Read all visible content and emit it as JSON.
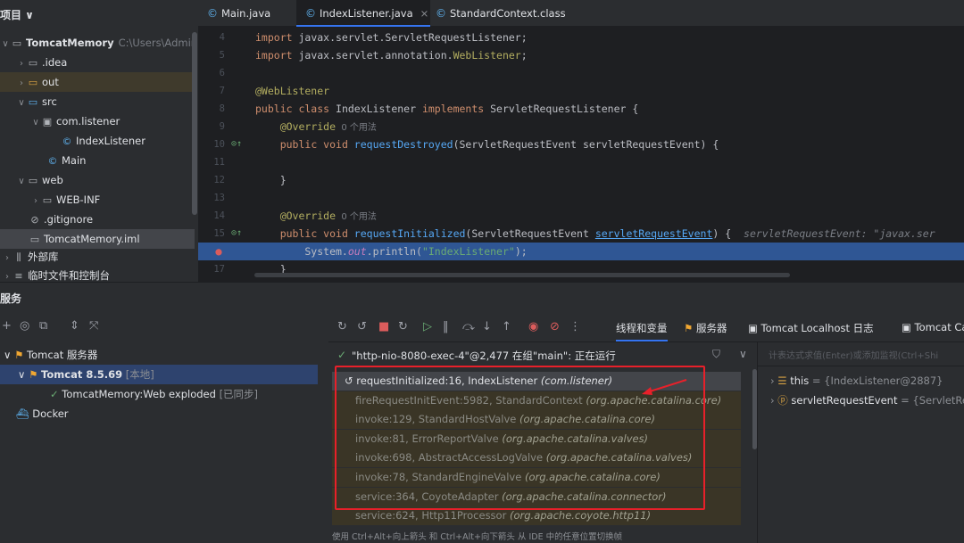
{
  "project": {
    "title": "项目 ∨",
    "root": {
      "name": "TomcatMemory",
      "path": "C:\\Users\\Administ"
    },
    "items": [
      {
        "label": ".idea"
      },
      {
        "label": "out"
      },
      {
        "label": "src"
      },
      {
        "label": "com.listener"
      },
      {
        "label": "IndexListener"
      },
      {
        "label": "Main"
      },
      {
        "label": "web"
      },
      {
        "label": "WEB-INF"
      },
      {
        "label": ".gitignore"
      },
      {
        "label": "TomcatMemory.iml"
      },
      {
        "label": "外部库"
      },
      {
        "label": "临时文件和控制台"
      }
    ]
  },
  "tabs": [
    {
      "label": "Main.java"
    },
    {
      "label": "IndexListener.java",
      "close": "×"
    },
    {
      "label": "StandardContext.class"
    }
  ],
  "editor": {
    "lines": [
      {
        "num": "4",
        "parts": [
          [
            "kw",
            "import "
          ],
          [
            "",
            "javax.servlet.ServletRequestListener;"
          ]
        ]
      },
      {
        "num": "5",
        "parts": [
          [
            "kw",
            "import "
          ],
          [
            "",
            "javax.servlet.annotation."
          ],
          [
            "an",
            "WebListener"
          ],
          [
            "",
            ";"
          ]
        ]
      },
      {
        "num": "6",
        "parts": []
      },
      {
        "num": "7",
        "parts": [
          [
            "an",
            "@WebListener"
          ]
        ]
      },
      {
        "num": "8",
        "parts": [
          [
            "kw",
            "public class "
          ],
          [
            "",
            "IndexListener "
          ],
          [
            "kw",
            "implements "
          ],
          [
            "",
            "ServletRequestListener {"
          ]
        ]
      },
      {
        "num": "9",
        "parts": [
          [
            "",
            "    "
          ],
          [
            "an",
            "@Override"
          ],
          [
            "hint",
            "  0 个用法"
          ]
        ]
      },
      {
        "num": "10",
        "parts": [
          [
            "",
            "    "
          ],
          [
            "kw",
            "public void "
          ],
          [
            "fn",
            "requestDestroyed"
          ],
          [
            "",
            "(ServletRequestEvent servletRequestEvent) {"
          ]
        ]
      },
      {
        "num": "11",
        "parts": []
      },
      {
        "num": "12",
        "parts": [
          [
            "",
            "    }"
          ]
        ]
      },
      {
        "num": "13",
        "parts": []
      },
      {
        "num": "14",
        "parts": [
          [
            "",
            "    "
          ],
          [
            "an",
            "@Override"
          ],
          [
            "hint",
            "  0 个用法"
          ]
        ]
      },
      {
        "num": "15",
        "parts": [
          [
            "",
            "    "
          ],
          [
            "kw",
            "public void "
          ],
          [
            "fn",
            "requestInitialized"
          ],
          [
            "",
            "(ServletRequestEvent "
          ],
          [
            "pu",
            "servletRequestEvent"
          ],
          [
            "",
            ") {  "
          ],
          [
            "inl",
            "servletRequestEvent: \"javax.ser"
          ]
        ]
      },
      {
        "num": "",
        "parts": [
          [
            "",
            "        System."
          ],
          [
            "fl",
            "out"
          ],
          [
            "",
            ".println("
          ],
          [
            "st",
            "\"IndexListener\""
          ],
          [
            "",
            ");"
          ]
        ]
      },
      {
        "num": "17",
        "parts": [
          [
            "",
            "    }"
          ]
        ]
      }
    ]
  },
  "services": {
    "title": "服务",
    "tree": [
      {
        "label": "Tomcat 服务器"
      },
      {
        "label": "Tomcat 8.5.69",
        "tag": "[本地]"
      },
      {
        "label": "TomcatMemory:Web exploded",
        "tag": "[已同步]"
      },
      {
        "label": "Docker"
      }
    ]
  },
  "debugger": {
    "tabs": [
      {
        "label": "线程和变量"
      },
      {
        "label": "服务器"
      },
      {
        "label": "Tomcat Localhost 日志"
      },
      {
        "label": "Tomcat Ca"
      }
    ],
    "thread": "\"http-nio-8080-exec-4\"@2,477 在组\"main\": 正在运行",
    "frames": [
      {
        "method": "requestInitialized:16, IndexListener",
        "pkg": "(com.listener)"
      },
      {
        "method": "fireRequestInitEvent:5982, StandardContext",
        "pkg": "(org.apache.catalina.core)"
      },
      {
        "method": "invoke:129, StandardHostValve",
        "pkg": "(org.apache.catalina.core)"
      },
      {
        "method": "invoke:81, ErrorReportValve",
        "pkg": "(org.apache.catalina.valves)"
      },
      {
        "method": "invoke:698, AbstractAccessLogValve",
        "pkg": "(org.apache.catalina.valves)"
      },
      {
        "method": "invoke:78, StandardEngineValve",
        "pkg": "(org.apache.catalina.core)"
      },
      {
        "method": "service:364, CoyoteAdapter",
        "pkg": "(org.apache.catalina.connector)"
      },
      {
        "method": "service:624, Http11Processor",
        "pkg": "(org.apache.coyote.http11)"
      }
    ],
    "status_hint": "使用 Ctrl+Alt+向上箭头 和 Ctrl+Alt+向下箭头 从 IDE 中的任意位置切换帧",
    "eval_placeholder": "计表达式求值(Enter)或添加监视(Ctrl+Shi",
    "vars": [
      {
        "name": "this",
        "value": "= {IndexListener@2887}"
      },
      {
        "name": "servletRequestEvent",
        "value": "= {ServletRequ"
      }
    ]
  },
  "colors": {
    "accent": "#3574f0",
    "exec_line": "#2f5694",
    "highlight_box": "#e8202a"
  }
}
